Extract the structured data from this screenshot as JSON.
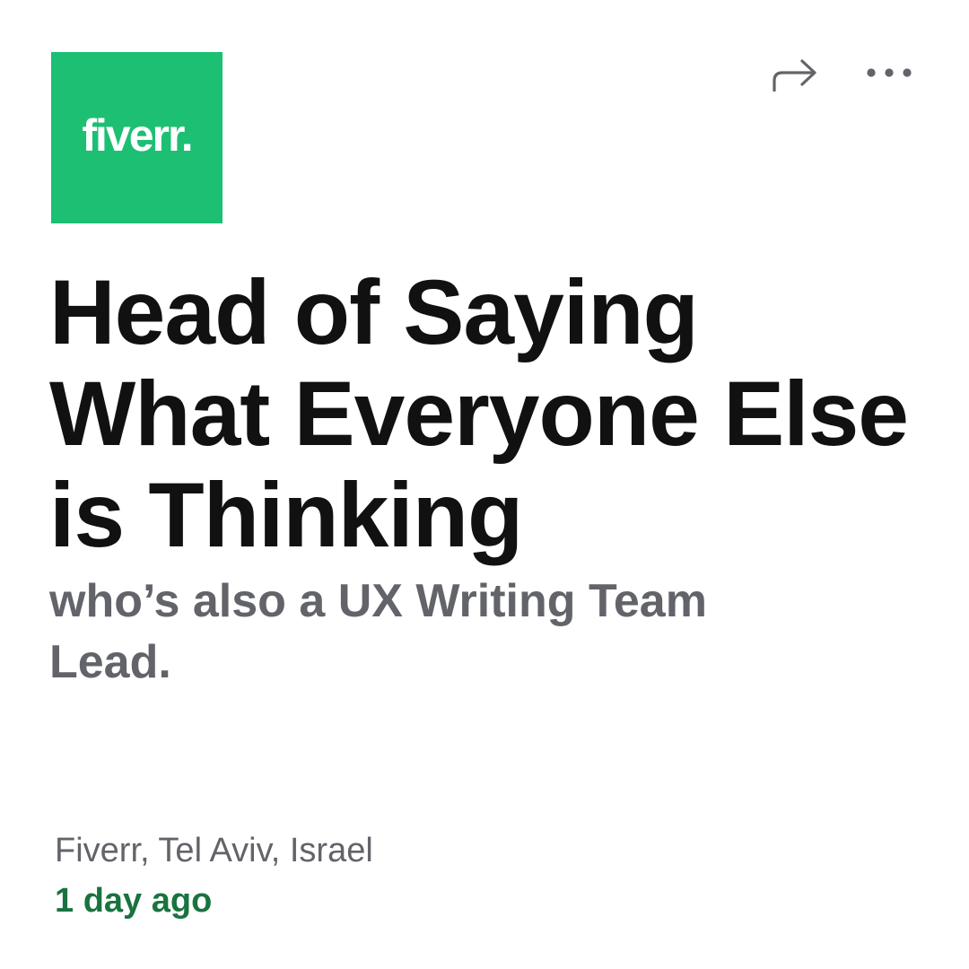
{
  "logo": {
    "text": "fiverr.",
    "background_color": "#1dbf73"
  },
  "actions": {
    "share_icon": "share-arrow-icon",
    "more_icon": "more-horizontal-icon"
  },
  "job": {
    "title": "Head of Saying What Everyone Else is Thinking",
    "subtitle": "who’s also a UX Writing Team Lead.",
    "location": "Fiverr, Tel Aviv, Israel",
    "posted": "1 day ago"
  },
  "colors": {
    "title": "#111111",
    "subtitle": "#62646a",
    "posted": "#19733f",
    "icons": "#62646a"
  }
}
